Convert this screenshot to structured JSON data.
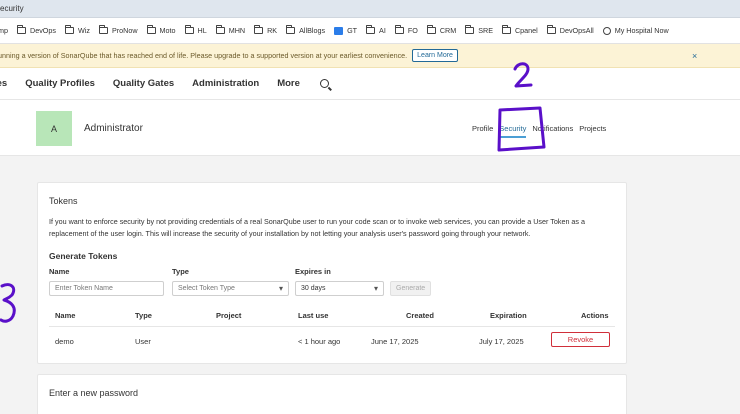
{
  "browser": {
    "tab_title": "ecurity",
    "bookmarks": [
      "mp",
      "DevOps",
      "Wiz",
      "ProNow",
      "Moto",
      "HL",
      "MHN",
      "RK",
      "AllBlogs",
      "GT",
      "AI",
      "FO",
      "CRM",
      "SRE",
      "Cpanel",
      "DevOpsAll",
      "My Hospital Now"
    ]
  },
  "banner": {
    "text": "unning a version of SonarQube that has reached end of life. Please upgrade to a supported version at your earliest convenience.",
    "button": "Learn More",
    "close": "×"
  },
  "nav": {
    "items": [
      "ies",
      "Quality Profiles",
      "Quality Gates",
      "Administration",
      "More"
    ],
    "search_icon": "search-icon"
  },
  "profile": {
    "avatar_letter": "A",
    "name": "Administrator",
    "tabs": [
      "Profile",
      "Security",
      "Notifications",
      "Projects"
    ],
    "active_tab": "Security"
  },
  "tokens": {
    "title": "Tokens",
    "description": "If you want to enforce security by not providing credentials of a real SonarQube user to run your code scan or to invoke web services, you can provide a User Token as a replacement of the user login. This will increase the security of your installation by not letting your analysis user's password going through your network.",
    "generate_title": "Generate Tokens",
    "labels": {
      "name": "Name",
      "type": "Type",
      "expires": "Expires in"
    },
    "name_placeholder": "Enter Token Name",
    "type_placeholder": "Select Token Type",
    "expires_value": "30 days",
    "generate_button": "Generate",
    "columns": [
      "Name",
      "Type",
      "Project",
      "Last use",
      "Created",
      "Expiration",
      "Actions"
    ],
    "rows": [
      {
        "name": "demo",
        "type": "User",
        "project": "",
        "last_use": "< 1 hour ago",
        "created": "June 17, 2025",
        "expiration": "July 17, 2025",
        "action": "Revoke"
      }
    ]
  },
  "password": {
    "title": "Enter a new password"
  },
  "annotations": {
    "two": "2",
    "three": "3"
  },
  "colors": {
    "accent": "#236a97",
    "annotation": "#5a10c9",
    "danger": "#d02f3a",
    "banner_bg": "#fcf3d6",
    "avatar_bg": "#b8e6b8"
  }
}
